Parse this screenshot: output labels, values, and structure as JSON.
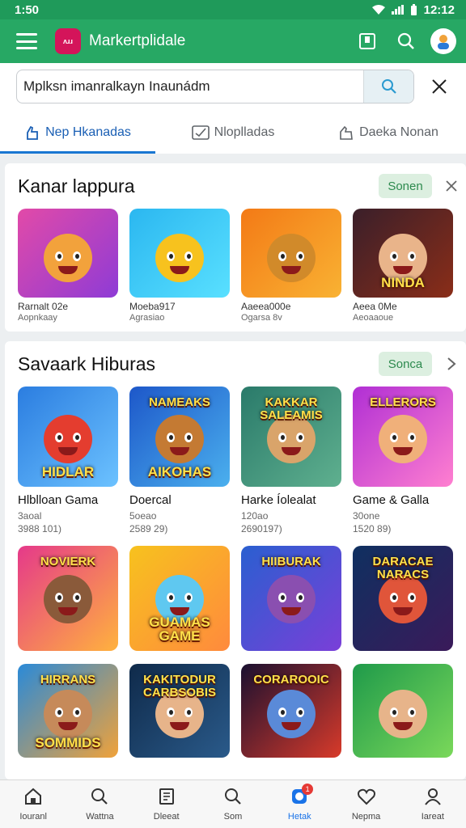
{
  "status": {
    "time": "1:50",
    "right_time": "12:12"
  },
  "app": {
    "logo_text": "ʌɹɹ",
    "title": "Markertplidale"
  },
  "search": {
    "value": "Mplksn  imanralkayn Inaunádm"
  },
  "tabs": [
    {
      "label": "Nep Hkanadas",
      "icon": "hand-icon",
      "active": true
    },
    {
      "label": "Nloplladas",
      "icon": "checkbox-icon",
      "active": false
    },
    {
      "label": "Daeka Nonan",
      "icon": "hand-icon",
      "active": false
    }
  ],
  "section1": {
    "title": "Kanar lappura",
    "button": "Sonen",
    "items": [
      {
        "name": "Rarnalt 02e",
        "sub": "Aopnkaay",
        "colors": [
          "#e24aa8",
          "#8e3bd6"
        ],
        "face": "#f2a23c",
        "top": "",
        "label": ""
      },
      {
        "name": "Moeba917",
        "sub": "Agrasiao",
        "colors": [
          "#2bb7f0",
          "#59e0ff"
        ],
        "face": "#f7c21e",
        "top": "",
        "label": ""
      },
      {
        "name": "Aaeea000e",
        "sub": "Ogarsa 8v",
        "colors": [
          "#f37a16",
          "#f9b233"
        ],
        "face": "#d18a2a",
        "top": "",
        "label": ""
      },
      {
        "name": "Aeea 0Me",
        "sub": "Aeoaaoue",
        "colors": [
          "#3a1f2a",
          "#8a2d18"
        ],
        "face": "#e9b48a",
        "top": "",
        "label": "NINDA"
      }
    ]
  },
  "section2": {
    "title": "Savaark Hiburas",
    "button": "Sonca",
    "items": [
      {
        "name": "Hlblloan Gama",
        "sub1": "3aoal",
        "sub2": "3988 101)",
        "colors": [
          "#2b7de0",
          "#6cc2ff"
        ],
        "face": "#e43d2f",
        "top": "",
        "label": "HIDLAR"
      },
      {
        "name": "Doercal",
        "sub1": "5oeao",
        "sub2": "2589 29)",
        "colors": [
          "#1d57c9",
          "#4bb0ee"
        ],
        "face": "#c47a33",
        "top": "NAMEAKS",
        "label": "AIKOHAS"
      },
      {
        "name": "Harke Íolealat",
        "sub1": "120ao",
        "sub2": "2690197)",
        "colors": [
          "#2a7a6a",
          "#5fb08f"
        ],
        "face": "#d9a46a",
        "top": "KAKKAR SALEAMIS",
        "label": ""
      },
      {
        "name": "Game & Galla",
        "sub1": "30one",
        "sub2": "1520 89)",
        "colors": [
          "#b02fd4",
          "#ff7fd0"
        ],
        "face": "#f0b07a",
        "top": "ELLERORS",
        "label": ""
      }
    ]
  },
  "section2_row2": [
    {
      "colors": [
        "#e5398a",
        "#ffb23e"
      ],
      "face": "#8a5a3a",
      "top": "NOVIERK",
      "label": ""
    },
    {
      "colors": [
        "#f7c21e",
        "#ff8a3d"
      ],
      "face": "#5fc8f0",
      "top": "",
      "label": "GUAMAS GAME"
    },
    {
      "colors": [
        "#2a5fd0",
        "#7a3fd8"
      ],
      "face": "#8a4fb0",
      "top": "HIIBURAK",
      "label": ""
    },
    {
      "colors": [
        "#0f3060",
        "#3a1a5a"
      ],
      "face": "#e0553a",
      "top": "DARACAE NARACS",
      "label": ""
    }
  ],
  "section2_row3": [
    {
      "colors": [
        "#2a8ad8",
        "#f0a23a"
      ],
      "face": "#c68a5a",
      "top": "HIRRANS",
      "label": "SOMMIDS"
    },
    {
      "colors": [
        "#0f2a4a",
        "#2a5a8a"
      ],
      "face": "#e7b48a",
      "top": "KAKITODUR CARBSOBIS",
      "label": ""
    },
    {
      "colors": [
        "#1a1030",
        "#d83a2a"
      ],
      "face": "#5a8ad8",
      "top": "CORAROOIC",
      "label": ""
    },
    {
      "colors": [
        "#1f9a4a",
        "#7ad85a"
      ],
      "face": "#e7b48a",
      "top": "",
      "label": ""
    }
  ],
  "bottom_nav": [
    {
      "label": "Iouranl",
      "icon": "home-icon",
      "active": false
    },
    {
      "label": "Wattna",
      "icon": "search-icon",
      "active": false
    },
    {
      "label": "Dleeat",
      "icon": "document-icon",
      "active": false
    },
    {
      "label": "Som",
      "icon": "search-icon",
      "active": false
    },
    {
      "label": "Hetak",
      "icon": "app-icon",
      "active": true,
      "badge": "1"
    },
    {
      "label": "Nepma",
      "icon": "heart-icon",
      "active": false
    },
    {
      "label": "Iareat",
      "icon": "person-icon",
      "active": false
    }
  ],
  "accent": "#27a864"
}
